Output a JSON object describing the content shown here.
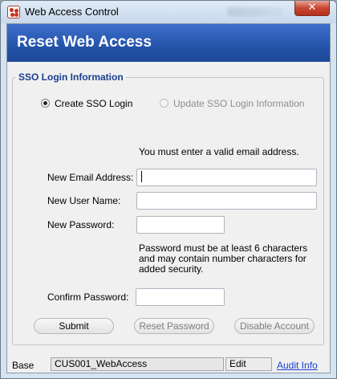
{
  "window": {
    "title": "Web Access Control",
    "close_glyph": "✕",
    "blurred_text": ""
  },
  "banner": {
    "title": "Reset Web Access",
    "color": "#2a59b4"
  },
  "group": {
    "legend": "SSO Login Information"
  },
  "mode": {
    "create": {
      "label": "Create SSO Login",
      "selected": true
    },
    "update": {
      "label": "Update SSO Login Information",
      "selected": false,
      "enabled": false
    }
  },
  "validation_message": "You must enter a valid email address.",
  "form": {
    "email": {
      "label": "New Email Address:",
      "value": ""
    },
    "username": {
      "label": "New User Name:",
      "value": ""
    },
    "password": {
      "label": "New Password:",
      "value": ""
    },
    "confirm": {
      "label": "Confirm Password:",
      "value": ""
    }
  },
  "password_hint": "Password must be at least 6 characters and may contain number characters for added security.",
  "buttons": {
    "submit": "Submit",
    "reset": "Reset Password",
    "disable": "Disable Account"
  },
  "status": {
    "base": "Base",
    "screen": "CUS001_WebAccess",
    "mode": "Edit",
    "audit": "Audit Info"
  },
  "icons": {
    "app": "app-icon",
    "close": "close-icon"
  }
}
